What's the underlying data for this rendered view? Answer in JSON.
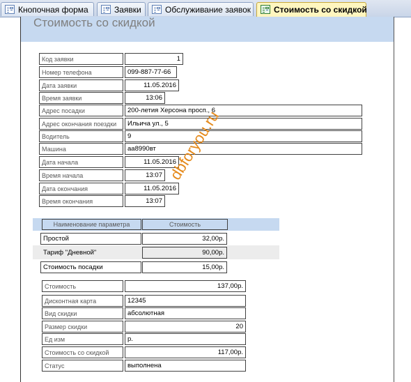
{
  "tabs": [
    {
      "label": "Кнопочная форма",
      "icon": "form-icon",
      "active": false
    },
    {
      "label": "Заявки",
      "icon": "form-icon",
      "active": false
    },
    {
      "label": "Обслуживание заявок",
      "icon": "form-icon",
      "active": false
    },
    {
      "label": "Стоимость со скидкой",
      "icon": "report-icon",
      "active": true
    }
  ],
  "report": {
    "title": "Стоимость со скидкой",
    "fields": [
      {
        "label": "Код заявки",
        "value": "1"
      },
      {
        "label": "Номер телефона",
        "value": "099-887-77-66"
      },
      {
        "label": "Дата заявки",
        "value": "11.05.2016"
      },
      {
        "label": "Время заявки",
        "value": "13:06"
      },
      {
        "label": "Адрес посадки",
        "value": "200-летия Херсона просп., 6"
      },
      {
        "label": "Адрес окончания поездки",
        "value": "Ильича ул., 5"
      },
      {
        "label": "Водитель",
        "value": "9"
      },
      {
        "label": "Машина",
        "value": "аа8990вт"
      },
      {
        "label": "Дата начала",
        "value": "11.05.2016"
      },
      {
        "label": "Время начала",
        "value": "13:07"
      },
      {
        "label": "Дата окончания",
        "value": "11.05.2016"
      },
      {
        "label": "Время окончания",
        "value": "13:07"
      }
    ],
    "params": {
      "headers": [
        "Наименование параметра",
        "Стоимость"
      ],
      "rows": [
        {
          "name": "Простой",
          "cost": "32,00р."
        },
        {
          "name": "Тариф \"Дневной\"",
          "cost": "90,00р."
        },
        {
          "name": "Стоимость посадки",
          "cost": "15,00р."
        }
      ]
    },
    "summary": [
      {
        "label": "Стоимость",
        "value": "137,00р."
      },
      {
        "label": "Дисконтная карта",
        "value": "12345"
      },
      {
        "label": "Вид скидки",
        "value": "абсолютная"
      },
      {
        "label": "Размер скидки",
        "value": "20"
      },
      {
        "label": "Ед изм",
        "value": "р."
      },
      {
        "label": "Стоимость со скидкой",
        "value": "117,00р."
      },
      {
        "label": "Статус",
        "value": "выполнена"
      }
    ]
  },
  "watermark": "dbforyou.ru",
  "colors": {
    "header_band": "#c6d9f0",
    "active_tab": "#fff6bf",
    "watermark": "#e58a1c"
  }
}
